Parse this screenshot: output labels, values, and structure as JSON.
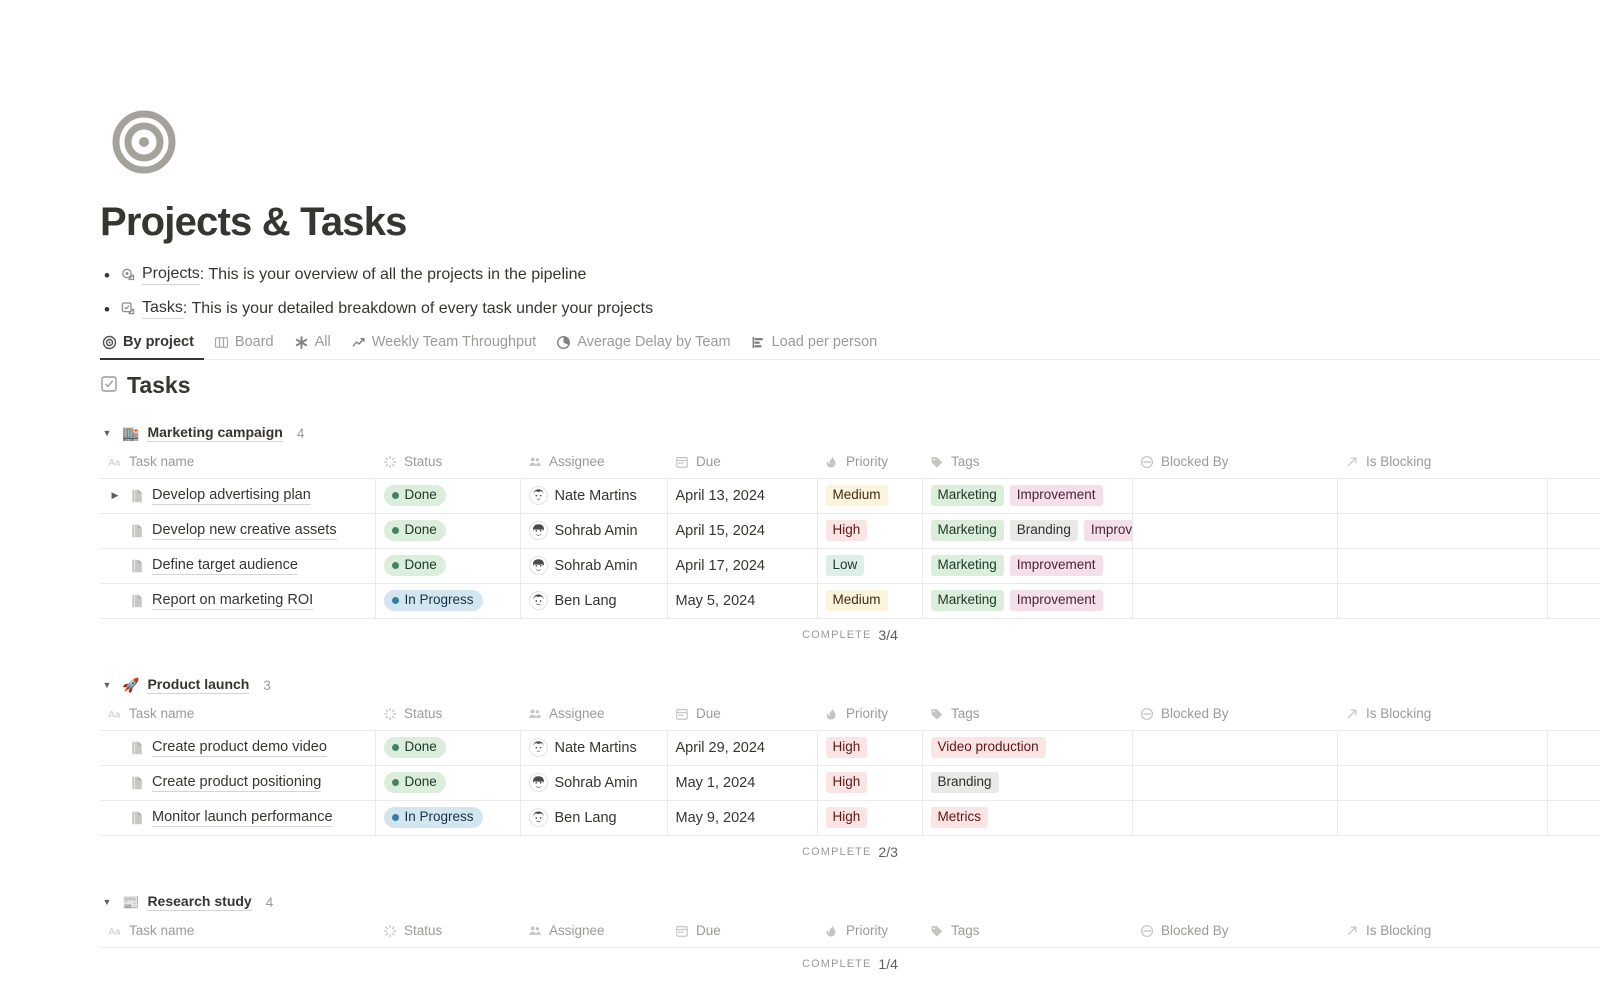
{
  "page": {
    "icon_name": "target-icon",
    "title": "Projects & Tasks",
    "bullets": [
      {
        "icon": "link-projects-icon",
        "link": "Projects",
        "text": ": This is your overview of all the projects in the pipeline"
      },
      {
        "icon": "link-tasks-icon",
        "link": "Tasks",
        "text": ": This is your detailed breakdown of every task under your projects"
      }
    ]
  },
  "tabs": [
    {
      "label": "By project",
      "icon": "target-icon",
      "active": true
    },
    {
      "label": "Board",
      "icon": "board-icon",
      "active": false
    },
    {
      "label": "All",
      "icon": "asterisk-icon",
      "active": false
    },
    {
      "label": "Weekly Team Throughput",
      "icon": "line-chart-icon",
      "active": false
    },
    {
      "label": "Average Delay by Team",
      "icon": "pie-chart-icon",
      "active": false
    },
    {
      "label": "Load per person",
      "icon": "bar-chart-icon",
      "active": false
    }
  ],
  "section": {
    "icon": "checkbox-icon",
    "title": "Tasks"
  },
  "columns": [
    {
      "key": "task",
      "label": "Task name",
      "icon": "aa-text-icon"
    },
    {
      "key": "status",
      "label": "Status",
      "icon": "status-spinner-icon"
    },
    {
      "key": "assignee",
      "label": "Assignee",
      "icon": "people-icon"
    },
    {
      "key": "due",
      "label": "Due",
      "icon": "calendar-icon"
    },
    {
      "key": "priority",
      "label": "Priority",
      "icon": "flame-icon"
    },
    {
      "key": "tags",
      "label": "Tags",
      "icon": "tag-icon"
    },
    {
      "key": "blocked_by",
      "label": "Blocked By",
      "icon": "blocked-icon"
    },
    {
      "key": "is_blocking",
      "label": "Is Blocking",
      "icon": "arrow-up-right-icon"
    }
  ],
  "groups": [
    {
      "emoji": "🏬",
      "name": "Marketing campaign",
      "count": "4",
      "complete_label": "COMPLETE",
      "complete_value": "3/4",
      "rows": [
        {
          "expandable": true,
          "task": "Develop advertising plan",
          "status": "Done",
          "status_type": "done",
          "assignee": "Nate Martins",
          "avatar": "nate",
          "due": "April 13, 2024",
          "priority": "Medium",
          "priority_color": "yellow",
          "tags": [
            {
              "label": "Marketing",
              "color": "mgreen"
            },
            {
              "label": "Improvement",
              "color": "pink"
            }
          ],
          "blocked_by": "",
          "is_blocking": ""
        },
        {
          "expandable": false,
          "task": "Develop new creative assets",
          "status": "Done",
          "status_type": "done",
          "assignee": "Sohrab Amin",
          "avatar": "sohrab",
          "due": "April 15, 2024",
          "priority": "High",
          "priority_color": "red",
          "tags": [
            {
              "label": "Marketing",
              "color": "mgreen"
            },
            {
              "label": "Branding",
              "color": "gray"
            },
            {
              "label": "Improvement",
              "color": "pink"
            }
          ],
          "blocked_by": "",
          "is_blocking": ""
        },
        {
          "expandable": false,
          "task": "Define target audience",
          "status": "Done",
          "status_type": "done",
          "assignee": "Sohrab Amin",
          "avatar": "sohrab",
          "due": "April 17, 2024",
          "priority": "Low",
          "priority_color": "green",
          "tags": [
            {
              "label": "Marketing",
              "color": "mgreen"
            },
            {
              "label": "Improvement",
              "color": "pink"
            }
          ],
          "blocked_by": "",
          "is_blocking": ""
        },
        {
          "expandable": false,
          "task": "Report on marketing ROI",
          "status": "In Progress",
          "status_type": "prog",
          "assignee": "Ben Lang",
          "avatar": "ben",
          "due": "May 5, 2024",
          "priority": "Medium",
          "priority_color": "yellow",
          "tags": [
            {
              "label": "Marketing",
              "color": "mgreen"
            },
            {
              "label": "Improvement",
              "color": "pink"
            }
          ],
          "blocked_by": "",
          "is_blocking": ""
        }
      ]
    },
    {
      "emoji": "🚀",
      "name": "Product launch",
      "count": "3",
      "complete_label": "COMPLETE",
      "complete_value": "2/3",
      "rows": [
        {
          "expandable": false,
          "task": "Create product demo video",
          "status": "Done",
          "status_type": "done",
          "assignee": "Nate Martins",
          "avatar": "nate",
          "due": "April 29, 2024",
          "priority": "High",
          "priority_color": "red",
          "tags": [
            {
              "label": "Video production",
              "color": "salmon"
            }
          ],
          "blocked_by": "",
          "is_blocking": ""
        },
        {
          "expandable": false,
          "task": "Create product positioning",
          "status": "Done",
          "status_type": "done",
          "assignee": "Sohrab Amin",
          "avatar": "sohrab",
          "due": "May 1, 2024",
          "priority": "High",
          "priority_color": "red",
          "tags": [
            {
              "label": "Branding",
              "color": "gray"
            }
          ],
          "blocked_by": "",
          "is_blocking": ""
        },
        {
          "expandable": false,
          "task": "Monitor launch performance",
          "status": "In Progress",
          "status_type": "prog",
          "assignee": "Ben Lang",
          "avatar": "ben",
          "due": "May 9, 2024",
          "priority": "High",
          "priority_color": "red",
          "tags": [
            {
              "label": "Metrics",
              "color": "salmon"
            }
          ],
          "blocked_by": "",
          "is_blocking": ""
        }
      ]
    },
    {
      "emoji": "📰",
      "name": "Research study",
      "count": "4",
      "complete_label": "COMPLETE",
      "complete_value": "1/4",
      "rows": []
    }
  ]
}
